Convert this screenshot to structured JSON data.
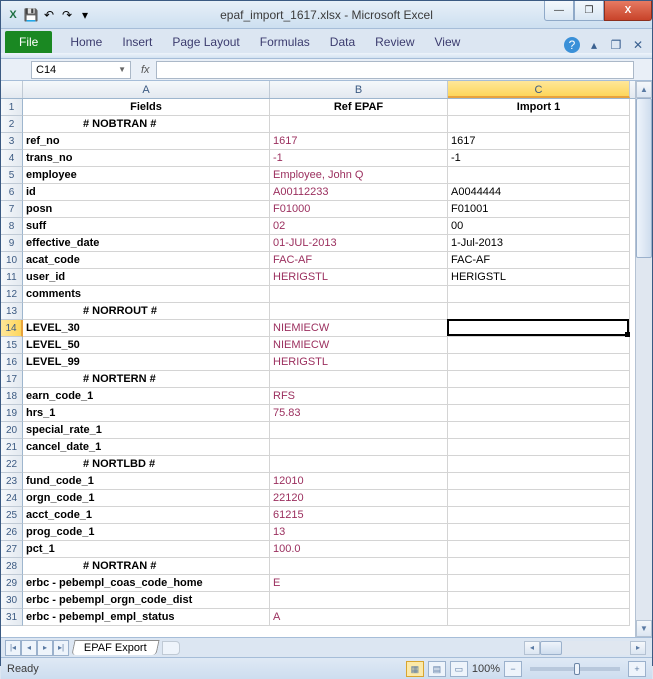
{
  "window": {
    "title": "epaf_import_1617.xlsx - Microsoft Excel"
  },
  "qat": {
    "save": "💾",
    "undo": "↶",
    "redo": "↷",
    "dropdown": "▾"
  },
  "ribbon": {
    "file": "File",
    "tabs": [
      "Home",
      "Insert",
      "Page Layout",
      "Formulas",
      "Data",
      "Review",
      "View"
    ],
    "help": "?",
    "min": "▴",
    "restore": "❐",
    "close": "✕"
  },
  "namebox": {
    "ref": "C14",
    "fx": "fx"
  },
  "columns": [
    "A",
    "B",
    "C"
  ],
  "headers": {
    "A": "Fields",
    "B": "Ref EPAF",
    "C": "Import 1"
  },
  "rows": [
    {
      "n": 1,
      "A": "Fields",
      "B": "Ref EPAF",
      "C": "Import 1",
      "hdr": true
    },
    {
      "n": 2,
      "A": "# NOBTRAN #",
      "sec": true
    },
    {
      "n": 3,
      "A": "ref_no",
      "B": "1617",
      "C": "1617"
    },
    {
      "n": 4,
      "A": "trans_no",
      "B": "-1",
      "C": "-1"
    },
    {
      "n": 5,
      "A": "employee",
      "B": "Employee, John Q"
    },
    {
      "n": 6,
      "A": "id",
      "B": "A00112233",
      "C": "A0044444"
    },
    {
      "n": 7,
      "A": "posn",
      "B": "F01000",
      "C": "F01001"
    },
    {
      "n": 8,
      "A": "suff",
      "B": "02",
      "C": "00"
    },
    {
      "n": 9,
      "A": "effective_date",
      "B": "01-JUL-2013",
      "C": "1-Jul-2013"
    },
    {
      "n": 10,
      "A": "acat_code",
      "B": "FAC-AF",
      "C": "FAC-AF"
    },
    {
      "n": 11,
      "A": "user_id",
      "B": "HERIGSTL",
      "C": "HERIGSTL"
    },
    {
      "n": 12,
      "A": "comments"
    },
    {
      "n": 13,
      "A": "# NORROUT #",
      "sec": true
    },
    {
      "n": 14,
      "A": "LEVEL_30",
      "B": "NIEMIECW",
      "sel": true
    },
    {
      "n": 15,
      "A": "LEVEL_50",
      "B": "NIEMIECW"
    },
    {
      "n": 16,
      "A": "LEVEL_99",
      "B": "HERIGSTL"
    },
    {
      "n": 17,
      "A": "# NORTERN #",
      "sec": true
    },
    {
      "n": 18,
      "A": "earn_code_1",
      "B": "RFS"
    },
    {
      "n": 19,
      "A": "hrs_1",
      "B": "75.83"
    },
    {
      "n": 20,
      "A": "special_rate_1"
    },
    {
      "n": 21,
      "A": "cancel_date_1"
    },
    {
      "n": 22,
      "A": "# NORTLBD #",
      "sec": true
    },
    {
      "n": 23,
      "A": "fund_code_1",
      "B": "12010"
    },
    {
      "n": 24,
      "A": "orgn_code_1",
      "B": "22120"
    },
    {
      "n": 25,
      "A": "acct_code_1",
      "B": "61215"
    },
    {
      "n": 26,
      "A": "prog_code_1",
      "B": "13"
    },
    {
      "n": 27,
      "A": "pct_1",
      "B": "100.0"
    },
    {
      "n": 28,
      "A": "# NORTRAN #",
      "sec": true
    },
    {
      "n": 29,
      "A": "erbc - pebempl_coas_code_home",
      "B": "E"
    },
    {
      "n": 30,
      "A": "erbc - pebempl_orgn_code_dist"
    },
    {
      "n": 31,
      "A": "erbc - pebempl_empl_status",
      "B": "A"
    }
  ],
  "sheet": {
    "name": "EPAF Export"
  },
  "status": {
    "text": "Ready",
    "zoom": "100%"
  },
  "active": {
    "row": 14,
    "col": "C"
  }
}
